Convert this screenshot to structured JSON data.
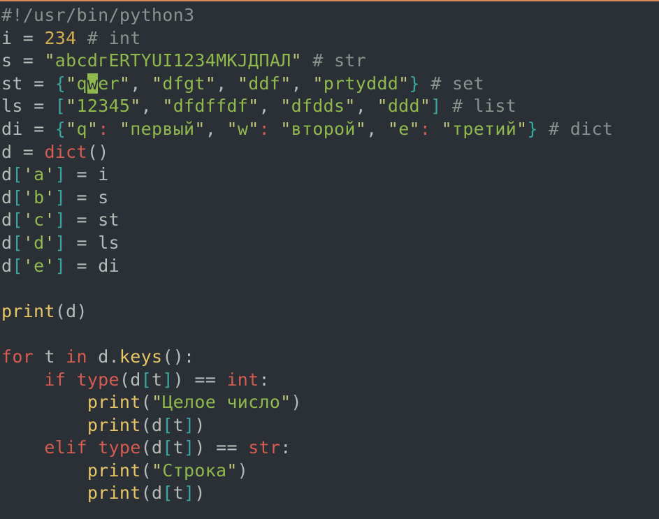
{
  "shebang": "#!/usr/bin/python3",
  "line2": {
    "var": "i",
    "eq": "=",
    "num": "234",
    "comment": "# int"
  },
  "line3": {
    "var": "s",
    "eq": "=",
    "q1": "\"",
    "str": "аbcdгERTYUI1234МКЈДПАЛ",
    "q2": "\"",
    "comment": "# str"
  },
  "line4": {
    "var": "st",
    "eq": "=",
    "lb": "{",
    "i1q1": "\"",
    "i1a": "q",
    "i1cur": "w",
    "i1b": "er",
    "i1q2": "\"",
    "c1": ",",
    "i2q1": "\"",
    "i2": "dfgt",
    "i2q2": "\"",
    "c2": ",",
    "i3q1": "\"",
    "i3": "ddf",
    "i3q2": "\"",
    "c3": ",",
    "i4q1": "\"",
    "i4": "prtyddd",
    "i4q2": "\"",
    "rb": "}",
    "comment": "# set"
  },
  "line5": {
    "var": "ls",
    "eq": "=",
    "lb": "[",
    "i1q1": "\"",
    "i1": "12345",
    "i1q2": "\"",
    "c1": ",",
    "i2q1": "\"",
    "i2": "dfdffdf",
    "i2q2": "\"",
    "c2": ",",
    "i3q1": "\"",
    "i3": "dfdds",
    "i3q2": "\"",
    "c3": ",",
    "i4q1": "\"",
    "i4": "ddd",
    "i4q2": "\"",
    "rb": "]",
    "comment": "# list"
  },
  "line6": {
    "var": "di",
    "eq": "=",
    "lb": "{",
    "k1q1": "\"",
    "k1": "q",
    "k1q2": "\"",
    "col1": ":",
    "v1q1": "\"",
    "v1": "первый",
    "v1q2": "\"",
    "c1": ",",
    "k2q1": "\"",
    "k2": "w",
    "k2q2": "\"",
    "col2": ":",
    "v2q1": "\"",
    "v2": "второй",
    "v2q2": "\"",
    "c2": ",",
    "k3q1": "\"",
    "k3": "e",
    "k3q2": "\"",
    "col3": ":",
    "v3q1": "\"",
    "v3": "третий",
    "v3q2": "\"",
    "rb": "}",
    "comment": "# dict"
  },
  "line7": {
    "var": "d",
    "eq": "=",
    "func": "dict",
    "lp": "(",
    "rp": ")"
  },
  "line8": {
    "d": "d",
    "lb": "[",
    "q1": "'",
    "k": "a",
    "q2": "'",
    "rb": "]",
    "eq": "=",
    "rhs": "i"
  },
  "line9": {
    "d": "d",
    "lb": "[",
    "q1": "'",
    "k": "b",
    "q2": "'",
    "rb": "]",
    "eq": "=",
    "rhs": "s"
  },
  "line10": {
    "d": "d",
    "lb": "[",
    "q1": "'",
    "k": "c",
    "q2": "'",
    "rb": "]",
    "eq": "=",
    "rhs": "st"
  },
  "line11": {
    "d": "d",
    "lb": "[",
    "q1": "'",
    "k": "d",
    "q2": "'",
    "rb": "]",
    "eq": "=",
    "rhs": "ls"
  },
  "line12": {
    "d": "d",
    "lb": "[",
    "q1": "'",
    "k": "e",
    "q2": "'",
    "rb": "]",
    "eq": "=",
    "rhs": "di"
  },
  "line14": {
    "func": "print",
    "lp": "(",
    "arg": "d",
    "rp": ")"
  },
  "line16": {
    "for": "for",
    "t": "t",
    "in": "in",
    "d": "d",
    "dot": ".",
    "keys": "keys",
    "lp": "(",
    "rp": ")",
    "col": ":"
  },
  "line17": {
    "if": "if",
    "type": "type",
    "lp": "(",
    "d": "d",
    "lb": "[",
    "t": "t",
    "rb": "]",
    "rp": ")",
    "eqeq": "==",
    "int": "int",
    "col": ":"
  },
  "line18": {
    "func": "print",
    "lp": "(",
    "q1": "\"",
    "s": "Целое число",
    "q2": "\"",
    "rp": ")"
  },
  "line19": {
    "func": "print",
    "lp": "(",
    "d": "d",
    "lb": "[",
    "t": "t",
    "rb": "]",
    "rp": ")"
  },
  "line20": {
    "elif": "elif",
    "type": "type",
    "lp": "(",
    "d": "d",
    "lb": "[",
    "t": "t",
    "rb": "]",
    "rp": ")",
    "eqeq": "==",
    "str": "str",
    "col": ":"
  },
  "line21": {
    "func": "print",
    "lp": "(",
    "q1": "\"",
    "s": "Строка",
    "q2": "\"",
    "rp": ")"
  },
  "line22": {
    "func": "print",
    "lp": "(",
    "d": "d",
    "lb": "[",
    "t": "t",
    "rb": "]",
    "rp": ")"
  }
}
